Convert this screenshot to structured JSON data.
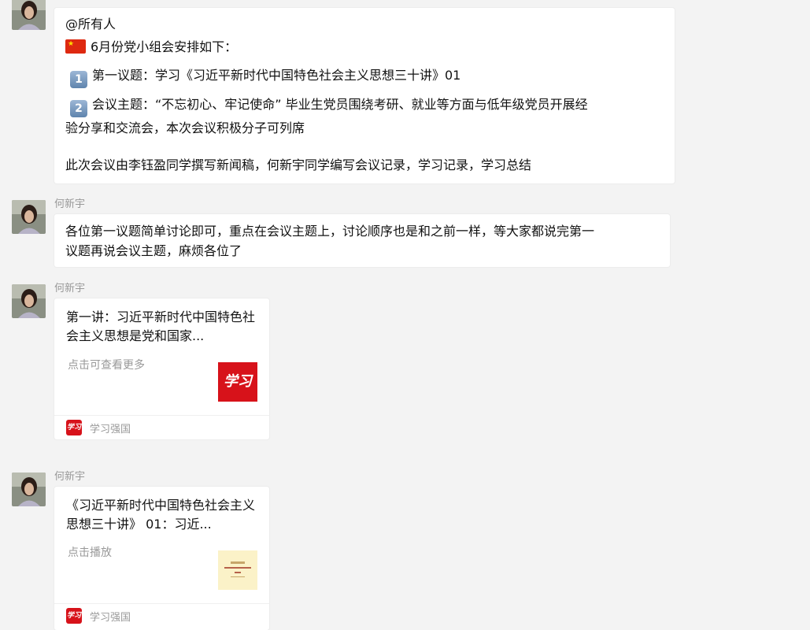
{
  "messages": {
    "m1": {
      "mention": "@所有人",
      "line1": "6月份党小组会安排如下：",
      "item1_num": "1",
      "item1": "第一议题：学习《习近平新时代中国特色社会主义思想三十讲》01",
      "item2_num": "2",
      "item2a": "会议主题：“不忘初心、牢记使命” 毕业生党员围绕考研、就业等方面与低年级党员开展经",
      "item2b": "验分享和交流会，本次会议积极分子可列席",
      "note": "此次会议由李钰盈同学撰写新闻稿，何新宇同学编写会议记录，学习记录，学习总结"
    },
    "m2": {
      "sender": "何新宇",
      "line1": "各位第一议题简单讨论即可，重点在会议主题上，讨论顺序也是和之前一样，等大家都说完第一",
      "line2": "议题再说会议主题，麻烦各位了"
    },
    "m3": {
      "sender": "何新宇",
      "title": "第一讲：习近平新时代中国特色社会主义思想是党和国家...",
      "desc": "点击可查看更多",
      "thumb_text": "学习",
      "source_icon": "学习",
      "source": "学习强国"
    },
    "m4": {
      "sender": "何新宇",
      "title": "《习近平新时代中国特色社会主义思想三十讲》 01：习近...",
      "desc": "点击播放",
      "source_icon": "学习",
      "source": "学习强国"
    }
  },
  "icons": {
    "flag": "china-flag-icon",
    "keycap1": "keycap-1-icon",
    "keycap2": "keycap-2-icon",
    "source": "xuexi-logo-icon"
  },
  "colors": {
    "background": "#f3f3f3",
    "bubble": "#ffffff",
    "brand_red": "#d7121a",
    "muted": "#999999"
  }
}
